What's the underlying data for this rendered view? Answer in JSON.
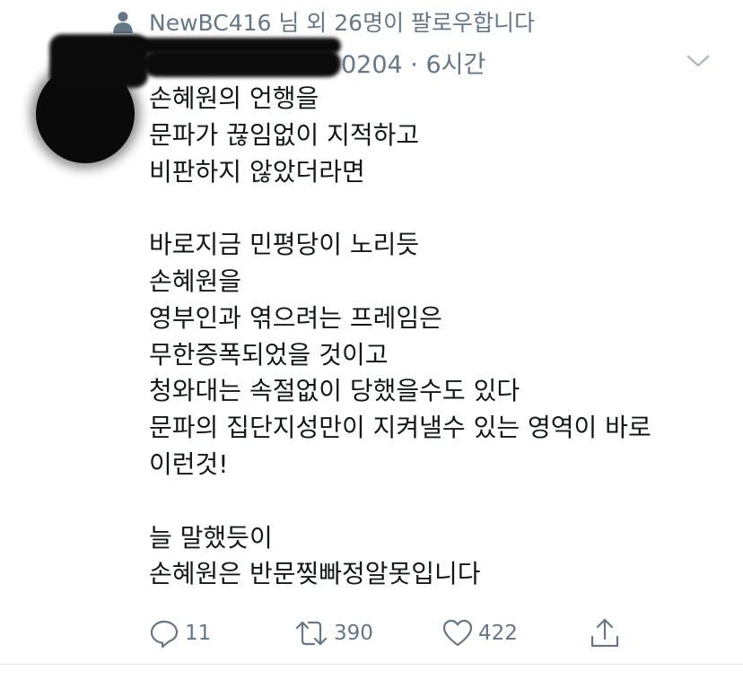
{
  "social_context": {
    "icon": "person-icon",
    "text": "NewBC416 님 외 26명이 팔로우합니다"
  },
  "tweet": {
    "meta": "0204 · 6시간",
    "lines": [
      "손혜원의 언행을",
      "문파가 끊임없이 지적하고",
      "비판하지 않았더라면",
      "",
      "바로지금 민평당이 노리듯",
      "손혜원을",
      "영부인과 엮으려는 프레임은",
      "무한증폭되었을 것이고",
      "청와대는 속절없이 당했을수도 있다",
      "문파의 집단지성만이 지켜낼수 있는 영역이 바로",
      "이런것!",
      "",
      "늘 말했듯이",
      "손혜원은 반문찢빠정알못입니다"
    ]
  },
  "actions": {
    "reply": {
      "icon": "reply-icon",
      "count": "11"
    },
    "retweet": {
      "icon": "retweet-icon",
      "count": "390"
    },
    "like": {
      "icon": "heart-icon",
      "count": "422"
    },
    "share": {
      "icon": "share-icon"
    }
  },
  "colors": {
    "text": "#14171a",
    "secondary": "#657786",
    "divider": "#e1e8ed"
  }
}
